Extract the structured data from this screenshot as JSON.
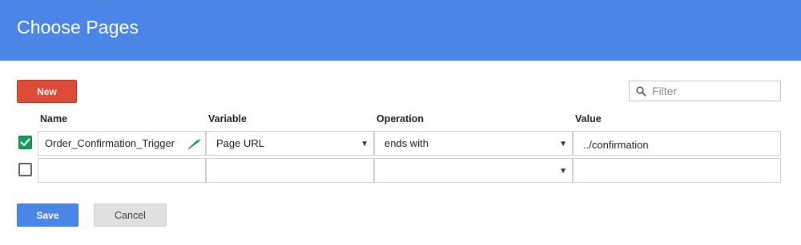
{
  "dialog": {
    "title": "Choose Pages"
  },
  "toolbar": {
    "new_label": "New",
    "filter_placeholder": "Filter",
    "filter_value": ""
  },
  "table": {
    "headers": [
      "Name",
      "Variable",
      "Operation",
      "Value"
    ],
    "rows": [
      {
        "checked": true,
        "name": "Order_Confirmation_Trigger",
        "variable": "Page URL",
        "operation": "ends with",
        "value": "../confirmation"
      },
      {
        "checked": false,
        "name": "",
        "variable": "",
        "operation": "",
        "value": ""
      }
    ]
  },
  "footer": {
    "save_label": "Save",
    "cancel_label": "Cancel"
  },
  "colors": {
    "header_bg": "#4a86e8",
    "new_button": "#dd4b39",
    "save_button": "#4a86e8",
    "checkbox_checked": "#0f9d58"
  }
}
